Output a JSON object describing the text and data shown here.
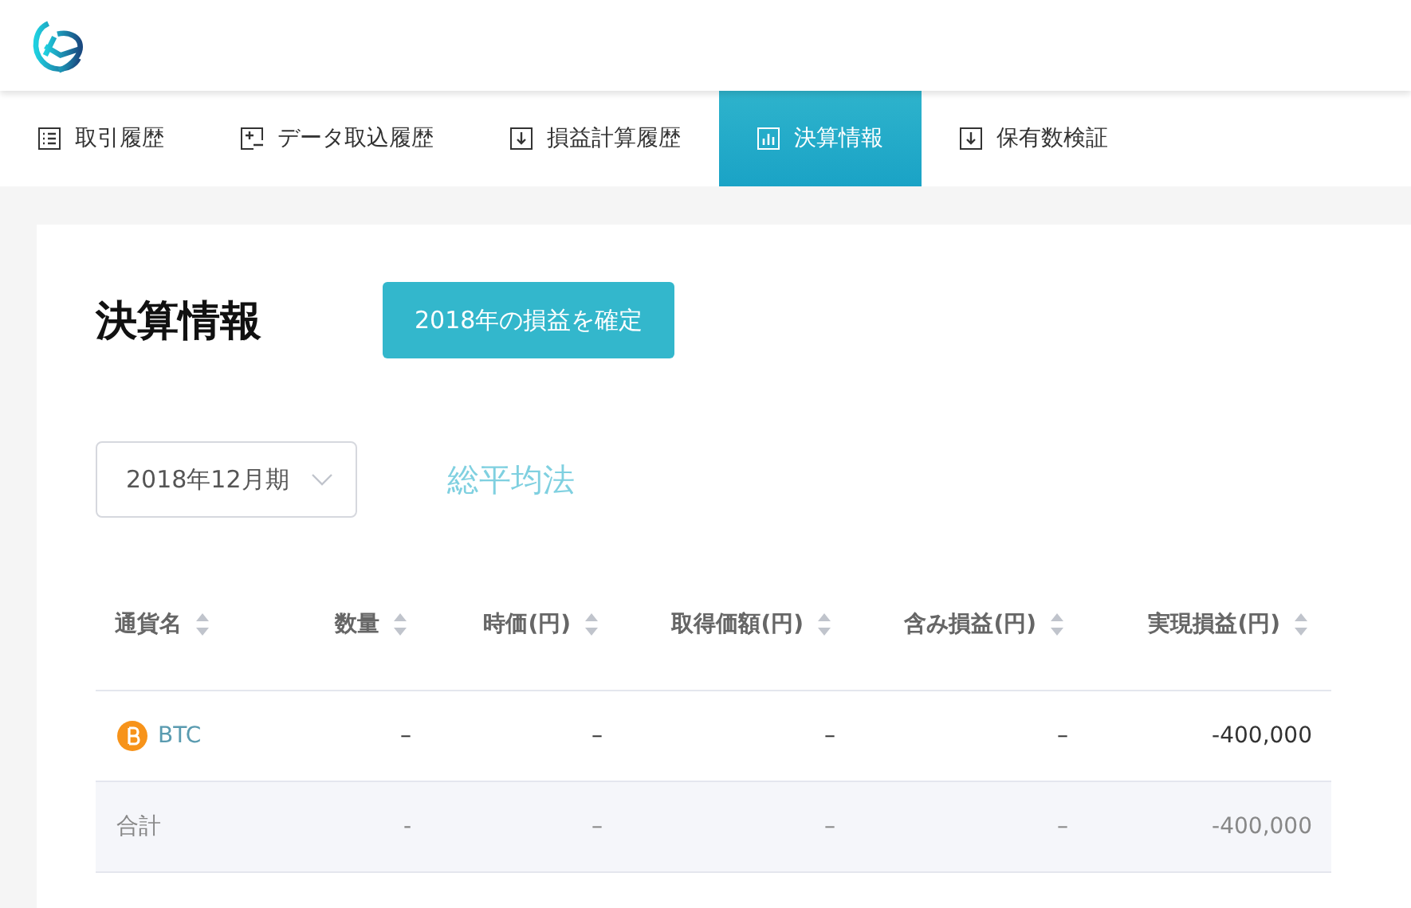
{
  "tabs": [
    {
      "label": "取引履歴",
      "kind": "list",
      "selected": false
    },
    {
      "label": "データ取込履歴",
      "kind": "import",
      "selected": false
    },
    {
      "label": "損益計算履歴",
      "kind": "download",
      "selected": false
    },
    {
      "label": "決算情報",
      "kind": "chart",
      "selected": true
    },
    {
      "label": "保有数検証",
      "kind": "download",
      "selected": false
    }
  ],
  "page_title": "決算情報",
  "confirm_button": "2018年の損益を確定",
  "period_select": {
    "value": "2018年12月期"
  },
  "method": "総平均法",
  "table": {
    "columns": [
      "通貨名",
      "数量",
      "時価(円)",
      "取得価額(円)",
      "含み損益(円)",
      "実現損益(円)"
    ],
    "rows": [
      {
        "kind": "coin",
        "cells": [
          "BTC",
          "–",
          "–",
          "–",
          "–",
          "-400,000"
        ]
      },
      {
        "kind": "total",
        "cells": [
          "合計",
          "-",
          "–",
          "–",
          "–",
          "-400,000"
        ]
      }
    ]
  }
}
